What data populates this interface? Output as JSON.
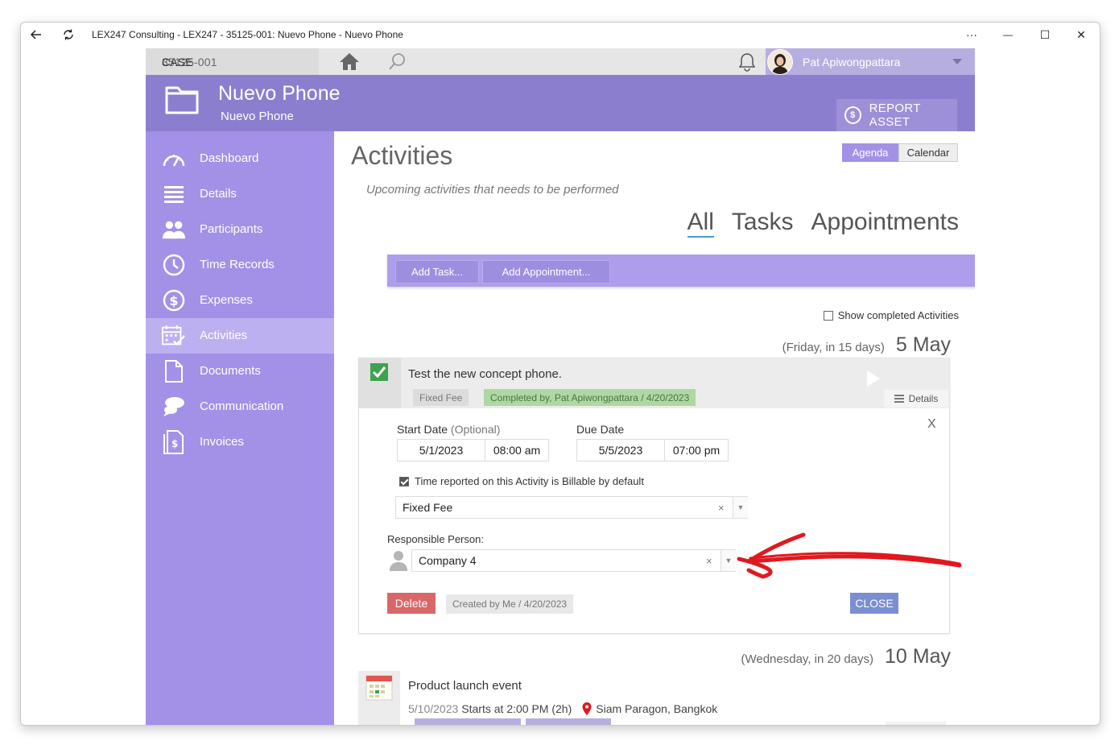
{
  "window": {
    "title": "LEX247 Consulting - LEX247 - 35125-001: Nuevo Phone - Nuevo Phone",
    "more_label": "···",
    "minimize_label": "—",
    "maximize_label": "☐",
    "close_label": "✕"
  },
  "topbar": {
    "case_label": "CASE",
    "case_number": "35125-001",
    "user_name": "Pat Apiwongpattara"
  },
  "header": {
    "title": "Nuevo Phone",
    "subtitle": "Nuevo Phone",
    "report_button": "REPORT ASSET"
  },
  "sidebar": {
    "items": [
      {
        "label": "Dashboard",
        "icon": "gauge-icon"
      },
      {
        "label": "Details",
        "icon": "list-icon"
      },
      {
        "label": "Participants",
        "icon": "people-icon"
      },
      {
        "label": "Time Records",
        "icon": "clock-icon"
      },
      {
        "label": "Expenses",
        "icon": "dollar-icon"
      },
      {
        "label": "Activities",
        "icon": "calendar-check-icon",
        "active": true
      },
      {
        "label": "Documents",
        "icon": "document-icon"
      },
      {
        "label": "Communication",
        "icon": "chat-icon"
      },
      {
        "label": "Invoices",
        "icon": "invoice-icon"
      }
    ]
  },
  "main": {
    "title": "Activities",
    "subtitle": "Upcoming activities that needs to be performed",
    "view_toggle": {
      "agenda": "Agenda",
      "calendar": "Calendar"
    },
    "filter_tabs": [
      "All",
      "Tasks",
      "Appointments"
    ],
    "add_task": "Add Task...",
    "add_appointment": "Add Appointment...",
    "show_completed": "Show completed Activities"
  },
  "group1": {
    "relative": "(Friday, in 15 days)",
    "date": "5 May"
  },
  "task": {
    "title": "Test the new concept phone.",
    "fee_tag": "Fixed Fee",
    "completed_tag": "Completed by, Pat Apiwongpattara / 4/20/2023",
    "details_label": "Details",
    "close_x": "X",
    "start_date_label": "Start Date",
    "optional_label": "(Optional)",
    "due_date_label": "Due Date",
    "start_date": "5/1/2023",
    "start_time": "08:00 am",
    "due_date": "5/5/2023",
    "due_time": "07:00 pm",
    "billable_label": "Time reported on this Activity is Billable by default",
    "billing_value": "Fixed Fee",
    "responsible_label": "Responsible Person:",
    "responsible_value": "Company 4",
    "clear_glyph": "×",
    "dropdown_glyph": "▼",
    "delete_label": "Delete",
    "created_label": "Created by Me / 4/20/2023",
    "close_label": "CLOSE"
  },
  "group2": {
    "relative": "(Wednesday, in 20 days)",
    "date": "10 May"
  },
  "event": {
    "title": "Product launch event",
    "date": "5/10/2023",
    "time": "Starts at 2:00 PM (2h)",
    "location": "Siam Paragon, Bangkok"
  },
  "colors": {
    "accent": "#8c7ecf",
    "sidebar": "#a291e6",
    "annotation_arrow": "#e0191f"
  }
}
